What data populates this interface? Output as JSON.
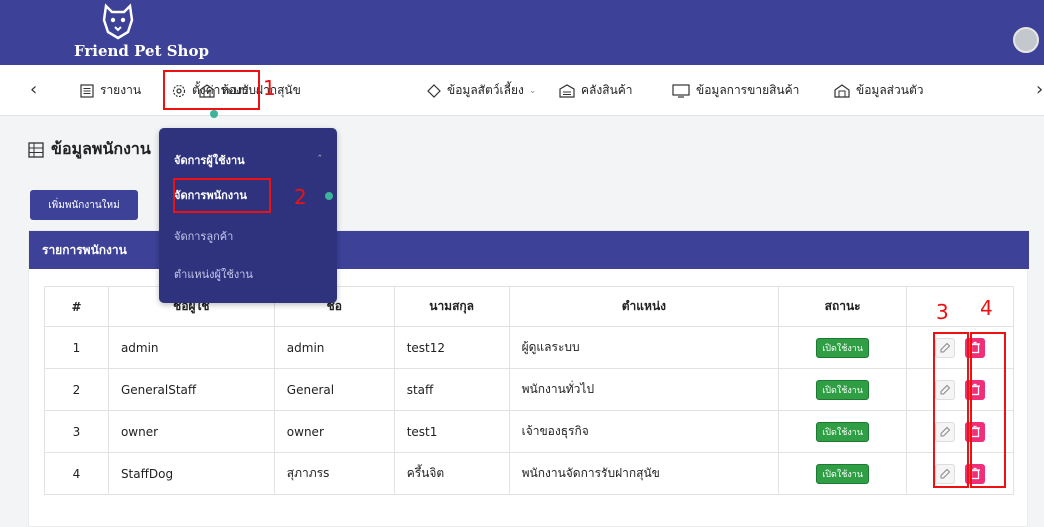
{
  "header": {
    "brand": "Friend Pet Shop"
  },
  "nav": {
    "items": [
      {
        "label": "รายงาน"
      },
      {
        "label": "ตั้งค่าระบบ"
      },
      {
        "label": "ห้องรับฝากสุนัข"
      },
      {
        "label": "ข้อมูลสัตว์เลี้ยง"
      },
      {
        "label": "คลังสินค้า"
      },
      {
        "label": "ข้อมูลการขายสินค้า"
      },
      {
        "label": "ข้อมูลส่วนตัว"
      }
    ]
  },
  "dropdown": {
    "group_label": "จัดการผู้ใช้งาน",
    "items": [
      {
        "label": "จัดการพนักงาน"
      },
      {
        "label": "จัดการลูกค้า"
      },
      {
        "label": "ตำแหน่งผู้ใช้งาน"
      }
    ]
  },
  "page": {
    "title": "ข้อมูลพนักงาน",
    "add_button": "เพิ่มพนักงานใหม่",
    "card_title": "รายการพนักงาน"
  },
  "table": {
    "headers": [
      "#",
      "ชื่อผู้ใช้",
      "ชื่อ",
      "นามสกุล",
      "ตำแหน่ง",
      "สถานะ",
      ""
    ],
    "rows": [
      {
        "no": "1",
        "username": "admin",
        "first": "admin",
        "last": "test12",
        "position": "ผู้ดูแลระบบ",
        "status": "เปิดใช้งาน"
      },
      {
        "no": "2",
        "username": "GeneralStaff",
        "first": "General",
        "last": "staff",
        "position": "พนักงานทั่วไป",
        "status": "เปิดใช้งาน"
      },
      {
        "no": "3",
        "username": "owner",
        "first": "owner",
        "last": "test1",
        "position": "เจ้าของธุรกิจ",
        "status": "เปิดใช้งาน"
      },
      {
        "no": "4",
        "username": "StaffDog",
        "first": "สุภาภรs",
        "last": "ครึ้นจิต",
        "position": "พนักงานจัดการรับฝากสุนัข",
        "status": "เปิดใช้งาน"
      }
    ]
  },
  "annotations": {
    "n1": "1",
    "n2": "2",
    "n3": "3",
    "n4": "4"
  },
  "colors": {
    "primary": "#3d4198",
    "badge": "#2f9e44",
    "delete": "#ef2f7a",
    "annotation": "#e11111"
  }
}
